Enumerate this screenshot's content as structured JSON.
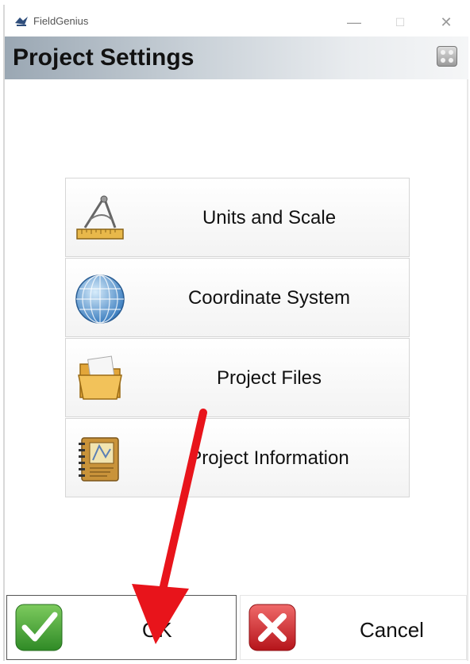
{
  "window": {
    "app_title": "FieldGenius",
    "minimize_glyph": "—",
    "maximize_glyph": "☐",
    "close_glyph": "✕"
  },
  "header": {
    "title": "Project Settings",
    "calculator_icon": "calculator-icon"
  },
  "menu": {
    "items": [
      {
        "label": "Units and Scale",
        "icon": "compass-ruler-icon"
      },
      {
        "label": "Coordinate System",
        "icon": "globe-icon"
      },
      {
        "label": "Project Files",
        "icon": "folder-icon"
      },
      {
        "label": "Project Information",
        "icon": "notebook-icon"
      }
    ]
  },
  "footer": {
    "ok_label": "OK",
    "ok_icon": "checkmark-icon",
    "cancel_label": "Cancel",
    "cancel_icon": "x-icon"
  },
  "colors": {
    "annotation_arrow": "#e8141b",
    "ok_green": "#3a9a2e",
    "cancel_red": "#d2222a"
  }
}
